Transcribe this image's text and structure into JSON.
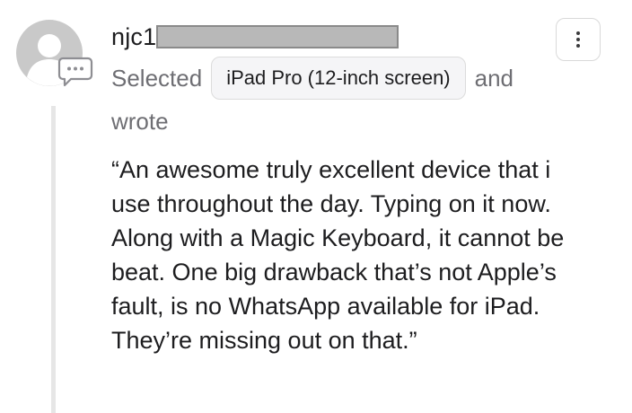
{
  "post": {
    "username_visible": "njc1",
    "meta": {
      "selected_label": "Selected",
      "product": "iPad Pro (12-inch screen)",
      "and_label": "and",
      "wrote_label": "wrote"
    },
    "review_lines": [
      "“An awesome truly excellent device that i",
      "use throughout the day. Typing on it now.",
      "Along with a Magic Keyboard, it cannot be",
      "beat. One big drawback that’s not Apple’s",
      "fault, is no WhatsApp available for iPad.",
      "They’re missing out on that.”"
    ]
  },
  "icons": {
    "avatar": "default-user-avatar-icon",
    "badge": "speech-bubble-icon",
    "more": "vertical-ellipsis-icon"
  },
  "colors": {
    "avatar_gray": "#c7c7c7",
    "secondary_text": "#6e6e73",
    "primary_text": "#1d1d1f",
    "chip_bg": "#f5f5f7",
    "thread_line": "#e6e6e6"
  }
}
